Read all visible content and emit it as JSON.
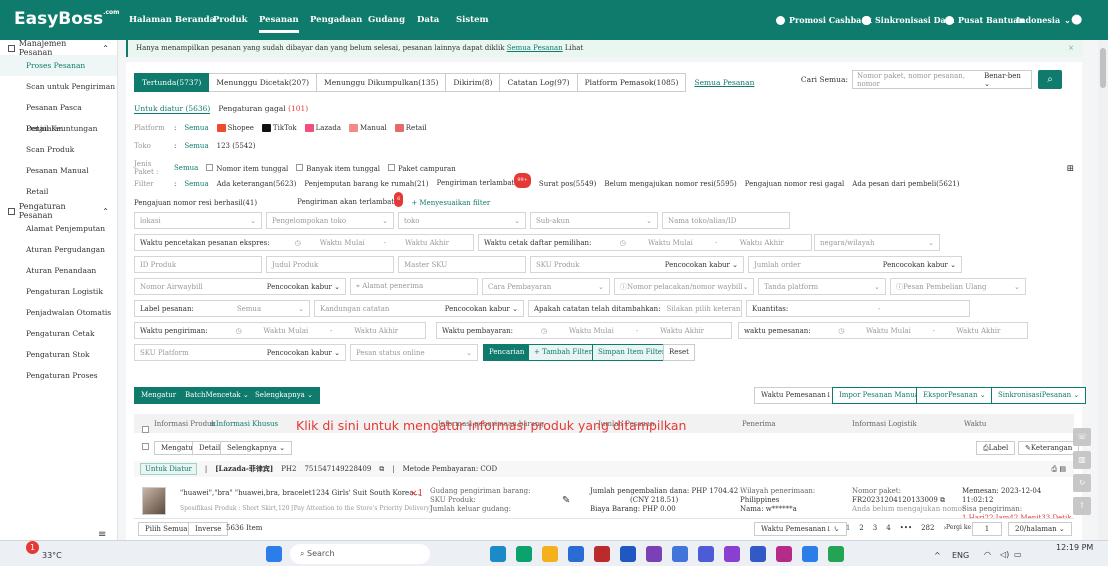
{
  "brand": {
    "name": "EasyBoss",
    "sup": ".com"
  },
  "nav": {
    "items": [
      "Halaman Beranda",
      "Produk",
      "Pesanan",
      "Pengadaan",
      "Gudang",
      "Data",
      "Sistem"
    ],
    "active": "Pesanan",
    "right": [
      "Promosi Cashback",
      "Sinkronisasi Data",
      "Pusat Bantuan",
      "Indonesia"
    ]
  },
  "sidebar": {
    "group1": "Manajemen Pesanan",
    "items1": [
      "Proses Pesanan",
      "Scan untuk Pengiriman",
      "Pesanan Pasca Penjualan",
      "Detail Keuntungan",
      "Scan Produk",
      "Pesanan Manual",
      "Retail"
    ],
    "group2": "Pengaturan Pesanan",
    "items2": [
      "Alamat Penjemputan",
      "Aturan Pergudangan",
      "Aturan Penandaan",
      "Pengaturan Logistik",
      "Penjadwalan Otomatis",
      "Pengaturan Cetak",
      "Pengaturan Stok",
      "Pengaturan Proses"
    ],
    "footer_icon": "≡"
  },
  "banner": {
    "text": "Hanya menampilkan pesanan yang sudah dibayar dan yang belum selesai, pesanan lainnya dapat diklik",
    "link": "Semua Pesanan",
    "link_suffix": "Lihat",
    "close": "×"
  },
  "tabs": [
    "Tertunda(5737)",
    "Menunggu Dicetak(207)",
    "Menunggu Dikumpulkan(135)",
    "Dikirim(8)",
    "Catatan Log(97)",
    "Platform Pemasok(1085)"
  ],
  "tabs_link": "Semua Pesanan",
  "search": {
    "label": "Cari Semua:",
    "placeholder": "Nomor paket, nomor pesanan, nomor",
    "mode": "Benar-ben"
  },
  "subtabs": {
    "a": "Untuk diatur (5636)",
    "b": "Pengaturan gagal",
    "b_count": "(101)"
  },
  "filters": {
    "platform_label": "Platform",
    "all": "Semua",
    "platforms": [
      "Shopee",
      "TikTok",
      "Lazada",
      "Manual",
      "Retail"
    ],
    "store_label": "Toko",
    "store": "123 (5542)",
    "type_label": "Jenis Paket :",
    "types": [
      "Nomor item tunggal",
      "Banyak item tunggal",
      "Paket campuran"
    ],
    "filter_label": "Filter",
    "filter_items": [
      "Ada keterangan(5623)",
      "Penjemputan barang ke rumah(21)",
      "Pengiriman terlambat",
      "Surat pos(5549)",
      "Belum mengajukan nomor resi(5595)",
      "Pengajuan nomor resi gagal",
      "Ada pesan dari pembeli(5621)",
      "Pengajuan nomor resi berhasil(41)"
    ],
    "late_badge": "99+",
    "late2": "Pengiriman akan terlambat",
    "late2_badge": "6",
    "custom": "+ Menyesuaikan filter"
  },
  "form": {
    "lokasi": "lokasi",
    "store_group": "Pengelompokan toko",
    "toko": "toko",
    "subakun": "Sub-akun",
    "store_name": "Nama toko/alias/ID",
    "print_label": "Waktu pencetakan pesanan ekspres:",
    "start": "Waktu Mulai",
    "dash": "-",
    "end": "Waktu Akhir",
    "pick_label": "Waktu cetak daftar pemilihan:",
    "region": "negara/wilayah",
    "product_id": "ID Produk",
    "product_title": "Judul Produk",
    "master_sku": "Master SKU",
    "sku_product": "SKU Produk",
    "fuzzy": "Pencocokan kabur",
    "qty": "Jumlah order",
    "airwaybill": "Nomor Airwaybill",
    "recipient_addr": "Alamat penerima",
    "payment": "Cara Pembayaran",
    "tracking": "Nomor pelacakan/nomor waybill",
    "platform_tag": "Tanda platform",
    "reorder": "Pesan Pembelian Ulang",
    "order_label": "Label pesanan:",
    "note_kw": "Kandungan catatan",
    "has_note": "Apakah catatan telah ditambahkan:",
    "choose_note": "Silakan pilih keterangan",
    "qty2": "Kuantitas:",
    "tilde": "-",
    "ship_time": "Waktu pengiriman:",
    "pay_time": "Waktu pembayaran:",
    "order_time": "waktu pemesanan:",
    "sku_platform": "SKU Platform",
    "online_status": "Pesan status online",
    "btn_search": "Pencarian",
    "btn_add": "+ Tambah Filter",
    "btn_save": "Simpan Item Filter",
    "btn_reset": "Reset"
  },
  "toolbar": {
    "arrange": "Mengatur",
    "batch": "BatchMencetak",
    "more": "Selengkapnya",
    "sort": "Waktu Pemesanan↓",
    "import": "Impor Pesanan Manual",
    "export": "EksporPesanan",
    "sync": "SinkronisasiPesanan"
  },
  "table": {
    "cols": [
      "Informasi Produk",
      "≡Informasi Khusus",
      "Informasi penerimaan barang",
      "Jumlah Pesanan",
      "Penerima",
      "Informasi Logistik",
      "Waktu"
    ],
    "overlay": "Klik di sini untuk mengatur informasi produk yang ditampilkan",
    "row_actions": [
      "Mengatur",
      "Detail",
      "Selengkapnya"
    ],
    "label_btn": "Label",
    "note_btn": "Keterangan",
    "order_status": "Untuk Diatur",
    "store_tag": "[Lazada-菲律宾]",
    "store_code": "PH2",
    "order_no": "751547149228409",
    "payment_method": "Metode Pembayaran: COD",
    "product_name": "\"huawei\",\"bra\" \"huawei,bra, bracelet1234 Girls' Suit South Korea...",
    "product_spec": "Spesifikasi Produk : Short Skirt,120 [Pay Attention to the Store's Priority Delivery]",
    "qty": "×1",
    "warehouse": "Gudang pengiriman barang:",
    "sku_label": "SKU Produk:",
    "out_qty": "Jumlah keluar gudang:",
    "total": "Jumlah pengembalian dana: PHP 1704.42",
    "cny": "(CNY 218.51)",
    "fee": "Biaya Barang: PHP 0.00",
    "region": "Wilayah penerimaan:",
    "country": "Philippines",
    "name": "Nama: w******a",
    "package_label": "Nomor paket:",
    "package_no": "FR20231204120133009",
    "track_note": "Anda belum mengajukan nomor",
    "order_time": "Memesan: 2023-12-04 11:02:12",
    "remain": "Sisa pengiriman:",
    "remain_val": "1 Hari22 Jam42 Menit33 Detik"
  },
  "pager": {
    "select_all": "Pilih Semua",
    "inverse": "Inverse",
    "count": "5636 Item",
    "sort": "Waktu Pemesanan↓",
    "pages": [
      "1",
      "2",
      "3",
      "4",
      "•••",
      "282"
    ],
    "goto": "Pergi ke",
    "page_val": "1",
    "per_page": "20/halaman"
  },
  "taskbar": {
    "temp": "33°C",
    "badge": "1",
    "search": "Search",
    "lang": "ENG",
    "time": "12:19 PM"
  },
  "colors": {
    "brand": "#0f7b6c",
    "alert": "#e53935"
  }
}
